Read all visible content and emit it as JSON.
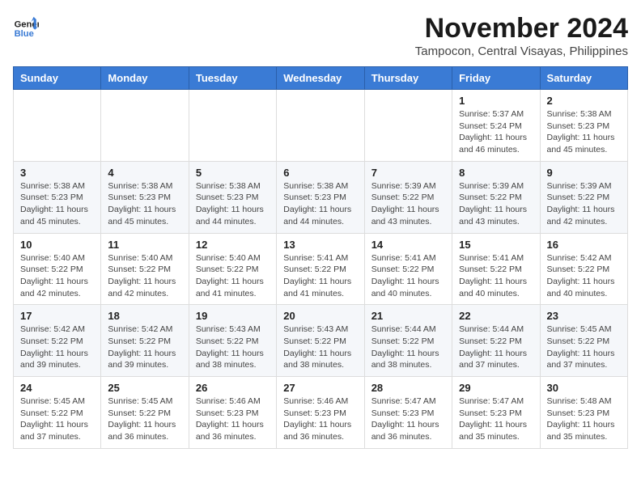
{
  "logo": {
    "line1": "General",
    "line2": "Blue"
  },
  "title": "November 2024",
  "location": "Tampocon, Central Visayas, Philippines",
  "weekdays": [
    "Sunday",
    "Monday",
    "Tuesday",
    "Wednesday",
    "Thursday",
    "Friday",
    "Saturday"
  ],
  "weeks": [
    [
      null,
      null,
      null,
      null,
      null,
      {
        "day": "1",
        "sunrise": "Sunrise: 5:37 AM",
        "sunset": "Sunset: 5:24 PM",
        "daylight": "Daylight: 11 hours and 46 minutes."
      },
      {
        "day": "2",
        "sunrise": "Sunrise: 5:38 AM",
        "sunset": "Sunset: 5:23 PM",
        "daylight": "Daylight: 11 hours and 45 minutes."
      }
    ],
    [
      {
        "day": "3",
        "sunrise": "Sunrise: 5:38 AM",
        "sunset": "Sunset: 5:23 PM",
        "daylight": "Daylight: 11 hours and 45 minutes."
      },
      {
        "day": "4",
        "sunrise": "Sunrise: 5:38 AM",
        "sunset": "Sunset: 5:23 PM",
        "daylight": "Daylight: 11 hours and 45 minutes."
      },
      {
        "day": "5",
        "sunrise": "Sunrise: 5:38 AM",
        "sunset": "Sunset: 5:23 PM",
        "daylight": "Daylight: 11 hours and 44 minutes."
      },
      {
        "day": "6",
        "sunrise": "Sunrise: 5:38 AM",
        "sunset": "Sunset: 5:23 PM",
        "daylight": "Daylight: 11 hours and 44 minutes."
      },
      {
        "day": "7",
        "sunrise": "Sunrise: 5:39 AM",
        "sunset": "Sunset: 5:22 PM",
        "daylight": "Daylight: 11 hours and 43 minutes."
      },
      {
        "day": "8",
        "sunrise": "Sunrise: 5:39 AM",
        "sunset": "Sunset: 5:22 PM",
        "daylight": "Daylight: 11 hours and 43 minutes."
      },
      {
        "day": "9",
        "sunrise": "Sunrise: 5:39 AM",
        "sunset": "Sunset: 5:22 PM",
        "daylight": "Daylight: 11 hours and 42 minutes."
      }
    ],
    [
      {
        "day": "10",
        "sunrise": "Sunrise: 5:40 AM",
        "sunset": "Sunset: 5:22 PM",
        "daylight": "Daylight: 11 hours and 42 minutes."
      },
      {
        "day": "11",
        "sunrise": "Sunrise: 5:40 AM",
        "sunset": "Sunset: 5:22 PM",
        "daylight": "Daylight: 11 hours and 42 minutes."
      },
      {
        "day": "12",
        "sunrise": "Sunrise: 5:40 AM",
        "sunset": "Sunset: 5:22 PM",
        "daylight": "Daylight: 11 hours and 41 minutes."
      },
      {
        "day": "13",
        "sunrise": "Sunrise: 5:41 AM",
        "sunset": "Sunset: 5:22 PM",
        "daylight": "Daylight: 11 hours and 41 minutes."
      },
      {
        "day": "14",
        "sunrise": "Sunrise: 5:41 AM",
        "sunset": "Sunset: 5:22 PM",
        "daylight": "Daylight: 11 hours and 40 minutes."
      },
      {
        "day": "15",
        "sunrise": "Sunrise: 5:41 AM",
        "sunset": "Sunset: 5:22 PM",
        "daylight": "Daylight: 11 hours and 40 minutes."
      },
      {
        "day": "16",
        "sunrise": "Sunrise: 5:42 AM",
        "sunset": "Sunset: 5:22 PM",
        "daylight": "Daylight: 11 hours and 40 minutes."
      }
    ],
    [
      {
        "day": "17",
        "sunrise": "Sunrise: 5:42 AM",
        "sunset": "Sunset: 5:22 PM",
        "daylight": "Daylight: 11 hours and 39 minutes."
      },
      {
        "day": "18",
        "sunrise": "Sunrise: 5:42 AM",
        "sunset": "Sunset: 5:22 PM",
        "daylight": "Daylight: 11 hours and 39 minutes."
      },
      {
        "day": "19",
        "sunrise": "Sunrise: 5:43 AM",
        "sunset": "Sunset: 5:22 PM",
        "daylight": "Daylight: 11 hours and 38 minutes."
      },
      {
        "day": "20",
        "sunrise": "Sunrise: 5:43 AM",
        "sunset": "Sunset: 5:22 PM",
        "daylight": "Daylight: 11 hours and 38 minutes."
      },
      {
        "day": "21",
        "sunrise": "Sunrise: 5:44 AM",
        "sunset": "Sunset: 5:22 PM",
        "daylight": "Daylight: 11 hours and 38 minutes."
      },
      {
        "day": "22",
        "sunrise": "Sunrise: 5:44 AM",
        "sunset": "Sunset: 5:22 PM",
        "daylight": "Daylight: 11 hours and 37 minutes."
      },
      {
        "day": "23",
        "sunrise": "Sunrise: 5:45 AM",
        "sunset": "Sunset: 5:22 PM",
        "daylight": "Daylight: 11 hours and 37 minutes."
      }
    ],
    [
      {
        "day": "24",
        "sunrise": "Sunrise: 5:45 AM",
        "sunset": "Sunset: 5:22 PM",
        "daylight": "Daylight: 11 hours and 37 minutes."
      },
      {
        "day": "25",
        "sunrise": "Sunrise: 5:45 AM",
        "sunset": "Sunset: 5:22 PM",
        "daylight": "Daylight: 11 hours and 36 minutes."
      },
      {
        "day": "26",
        "sunrise": "Sunrise: 5:46 AM",
        "sunset": "Sunset: 5:23 PM",
        "daylight": "Daylight: 11 hours and 36 minutes."
      },
      {
        "day": "27",
        "sunrise": "Sunrise: 5:46 AM",
        "sunset": "Sunset: 5:23 PM",
        "daylight": "Daylight: 11 hours and 36 minutes."
      },
      {
        "day": "28",
        "sunrise": "Sunrise: 5:47 AM",
        "sunset": "Sunset: 5:23 PM",
        "daylight": "Daylight: 11 hours and 36 minutes."
      },
      {
        "day": "29",
        "sunrise": "Sunrise: 5:47 AM",
        "sunset": "Sunset: 5:23 PM",
        "daylight": "Daylight: 11 hours and 35 minutes."
      },
      {
        "day": "30",
        "sunrise": "Sunrise: 5:48 AM",
        "sunset": "Sunset: 5:23 PM",
        "daylight": "Daylight: 11 hours and 35 minutes."
      }
    ]
  ]
}
